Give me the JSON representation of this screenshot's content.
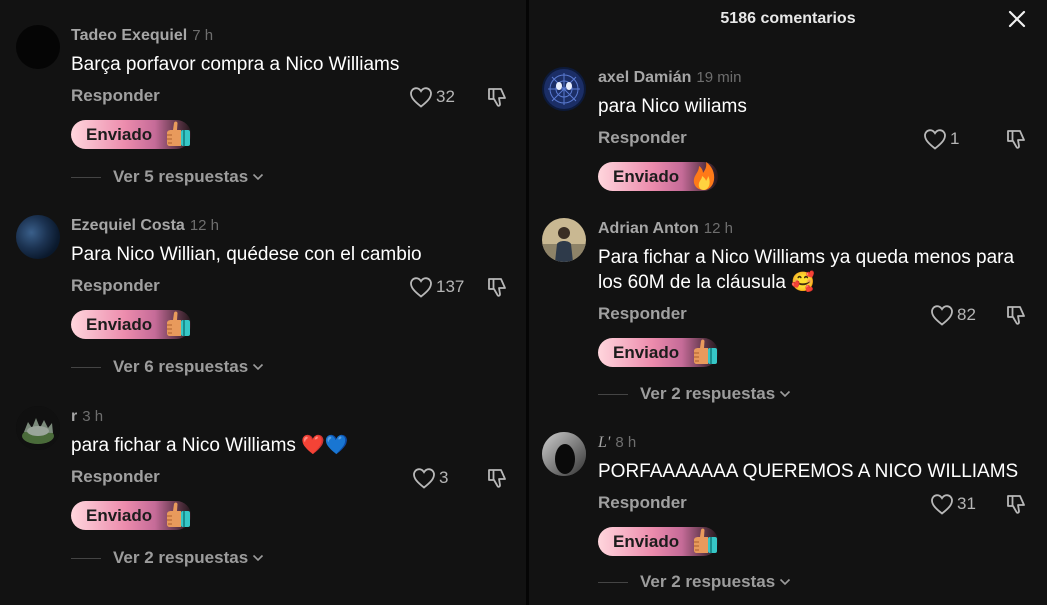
{
  "left": {
    "comments": [
      {
        "username": "Tadeo Exequiel",
        "time": "7 h",
        "text": "Barça porfavor compra a Nico Williams",
        "reply": "Responder",
        "likes": "32",
        "sent": "Enviado",
        "replies": "Ver 5 respuestas",
        "sent_emoji": "thumbs-up-emoji",
        "avatar": "avatar-black"
      },
      {
        "username": "Ezequiel Costa",
        "time": "12 h",
        "text": "Para Nico Willian, quédese con el cambio",
        "reply": "Responder",
        "likes": "137",
        "sent": "Enviado",
        "replies": "Ver 6 respuestas",
        "sent_emoji": "thumbs-up-emoji",
        "avatar": "avatar-blue-texture"
      },
      {
        "username": "r",
        "time": "3 h",
        "text": "para fichar a Nico Williams",
        "text_emoji": "❤️💙",
        "reply": "Responder",
        "likes": "3",
        "sent": "Enviado",
        "replies": "Ver 2 respuestas",
        "sent_emoji": "thumbs-up-emoji",
        "avatar": "avatar-cartoon"
      }
    ]
  },
  "right": {
    "header": {
      "title": "5186 comentarios"
    },
    "comments": [
      {
        "username": "axel Damián",
        "time": "19 min",
        "text": "para Nico wiliams",
        "reply": "Responder",
        "likes": "1",
        "sent": "Enviado",
        "sent_emoji": "fire-emoji",
        "avatar": "avatar-spiderman"
      },
      {
        "username": "Adrian Anton",
        "time": "12 h",
        "text": "Para fichar a Nico Williams ya queda menos para los 60M de la cláusula",
        "text_emoji": "🥰",
        "reply": "Responder",
        "likes": "82",
        "sent": "Enviado",
        "replies": "Ver 2 respuestas",
        "sent_emoji": "thumbs-up-emoji",
        "avatar": "avatar-photo"
      },
      {
        "username": "L'",
        "time": "8 h",
        "text": "PORFAAAAAAA QUEREMOS A NICO WILLIAMS",
        "reply": "Responder",
        "likes": "31",
        "sent": "Enviado",
        "replies": "Ver 2 respuestas",
        "sent_emoji": "thumbs-up-emoji",
        "avatar": "avatar-dark-photo"
      }
    ]
  },
  "colors": {
    "background": "#121212",
    "text": "#ffffff",
    "muted": "#a2a2a2",
    "badge_pink": "#ec8cad"
  },
  "icons": {
    "like": "heart-outline-icon",
    "dislike": "thumbs-down-outline-icon",
    "close": "close-icon",
    "expand": "chevron-down-icon"
  }
}
